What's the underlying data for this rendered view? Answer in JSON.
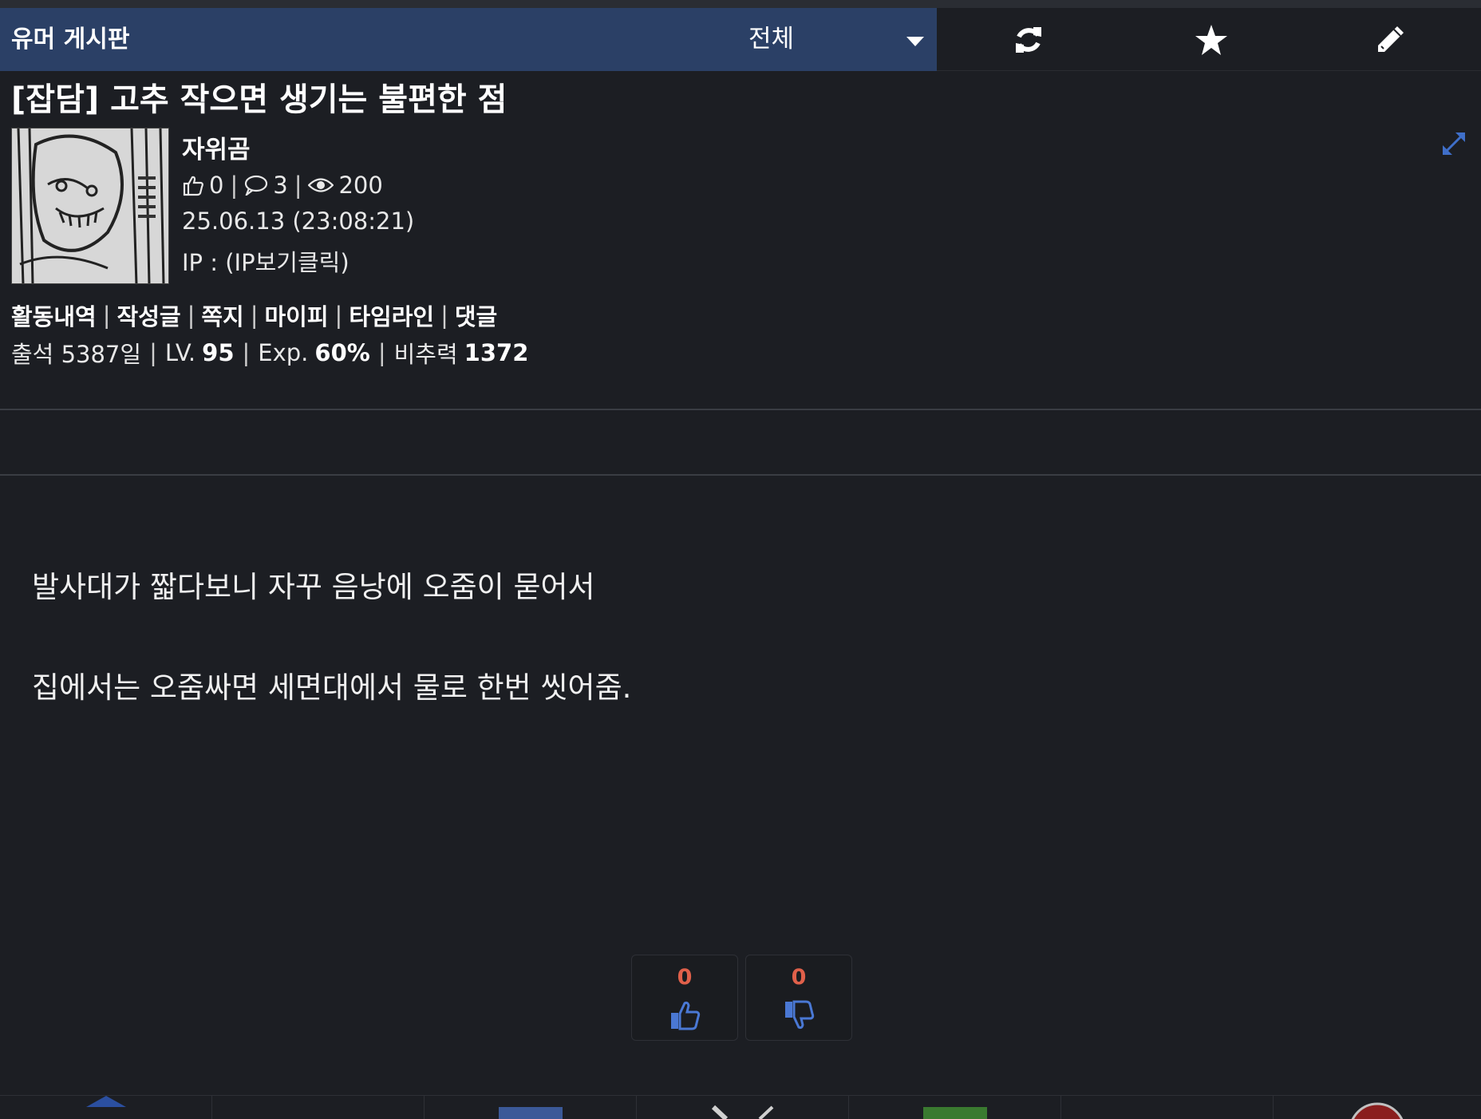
{
  "header": {
    "board_title": "유머 게시판",
    "category_selected": "전체",
    "tools": [
      "refresh-icon",
      "star-icon",
      "pencil-icon"
    ]
  },
  "post": {
    "title": "[잡담] 고추 작으면 생기는 불편한 점",
    "author": "자위곰",
    "likes": "0",
    "comments": "3",
    "views": "200",
    "date": "25.06.13 (23:08:21)",
    "ip": "IP : (IP보기클릭)",
    "body": [
      "발사대가 짧다보니 자꾸 음낭에 오줌이 묻어서",
      "집에서는 오줌싸면 세면대에서 물로 한번 씻어줌."
    ]
  },
  "member": {
    "links": [
      "활동내역",
      "작성글",
      "쪽지",
      "마이피",
      "타임라인",
      "댓글"
    ],
    "attendance": "출석 5387일",
    "level_label": "LV.",
    "level": "95",
    "exp_label": "Exp.",
    "exp": "60%",
    "power_label": "비추력",
    "power": "1372"
  },
  "votes": {
    "up": "0",
    "down": "0"
  },
  "colors": {
    "board_bar": "#2b4066",
    "background": "#1c1e23",
    "vote_count": "#e0604a",
    "vote_icon": "#4a78d4"
  }
}
